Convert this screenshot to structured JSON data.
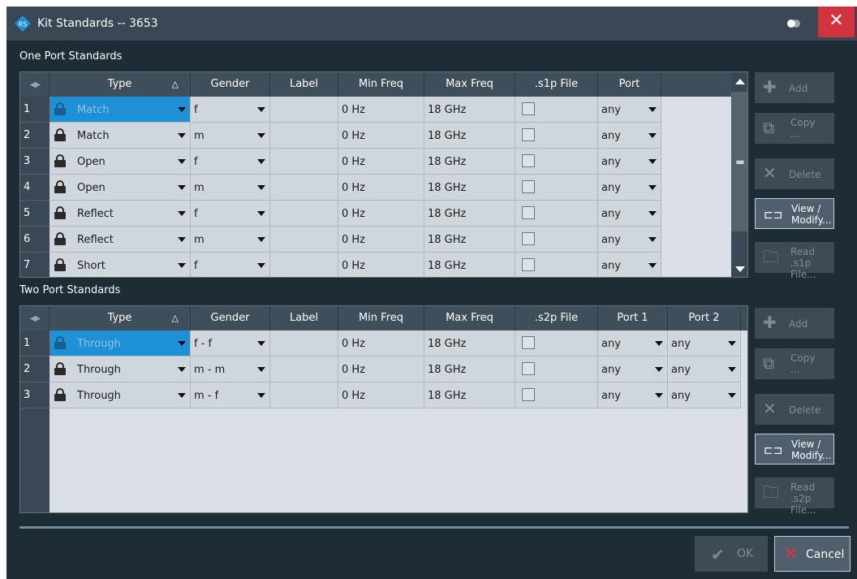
{
  "window": {
    "title": "Kit Standards -- 3653",
    "close_label": "✕"
  },
  "colors": {
    "accent_selected": "#1e90d6",
    "close": "#d1343f",
    "header": "#3f4e5b"
  },
  "one_port": {
    "section_title": "One Port Standards",
    "headers": [
      "",
      "Type",
      "Gender",
      "Label",
      "Min Freq",
      "Max Freq",
      ".s1p File",
      "Port"
    ],
    "sort_indicator": "△",
    "rows": [
      {
        "num": "1",
        "type": "Match",
        "gender": "f",
        "label": "",
        "min": "0 Hz",
        "max": "18 GHz",
        "port": "any"
      },
      {
        "num": "2",
        "type": "Match",
        "gender": "m",
        "label": "",
        "min": "0 Hz",
        "max": "18 GHz",
        "port": "any"
      },
      {
        "num": "3",
        "type": "Open",
        "gender": "f",
        "label": "",
        "min": "0 Hz",
        "max": "18 GHz",
        "port": "any"
      },
      {
        "num": "4",
        "type": "Open",
        "gender": "m",
        "label": "",
        "min": "0 Hz",
        "max": "18 GHz",
        "port": "any"
      },
      {
        "num": "5",
        "type": "Reflect",
        "gender": "f",
        "label": "",
        "min": "0 Hz",
        "max": "18 GHz",
        "port": "any"
      },
      {
        "num": "6",
        "type": "Reflect",
        "gender": "m",
        "label": "",
        "min": "0 Hz",
        "max": "18 GHz",
        "port": "any"
      },
      {
        "num": "7",
        "type": "Short",
        "gender": "f",
        "label": "",
        "min": "0 Hz",
        "max": "18 GHz",
        "port": "any"
      }
    ],
    "buttons": {
      "add": "Add",
      "copy": "Copy ...",
      "delete": "Delete",
      "view": "View / Modify...",
      "read": "Read .s1p File..."
    }
  },
  "two_port": {
    "section_title": "Two Port Standards",
    "headers": [
      "",
      "Type",
      "Gender",
      "Label",
      "Min Freq",
      "Max Freq",
      ".s2p File",
      "Port 1",
      "Port 2"
    ],
    "sort_indicator": "△",
    "rows": [
      {
        "num": "1",
        "type": "Through",
        "gender": "f - f",
        "label": "",
        "min": "0 Hz",
        "max": "18 GHz",
        "port1": "any",
        "port2": "any"
      },
      {
        "num": "2",
        "type": "Through",
        "gender": "m - m",
        "label": "",
        "min": "0 Hz",
        "max": "18 GHz",
        "port1": "any",
        "port2": "any"
      },
      {
        "num": "3",
        "type": "Through",
        "gender": "m - f",
        "label": "",
        "min": "0 Hz",
        "max": "18 GHz",
        "port1": "any",
        "port2": "any"
      }
    ],
    "buttons": {
      "add": "Add",
      "copy": "Copy ...",
      "delete": "Delete",
      "view": "View / Modify...",
      "read": "Read .s2p File..."
    }
  },
  "footer": {
    "ok": "OK",
    "cancel": "Cancel"
  }
}
